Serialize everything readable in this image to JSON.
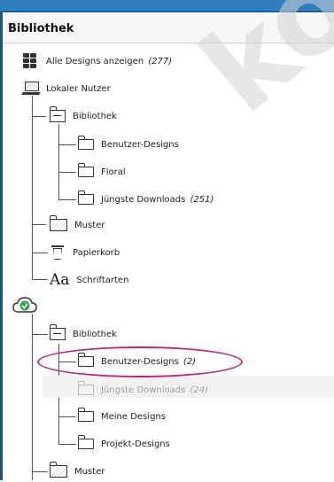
{
  "header": {
    "title": "Bibliothek"
  },
  "tree": {
    "all_designs": {
      "label": "Alle Designs anzeigen",
      "count": "(277)"
    },
    "local_user": {
      "label": "Lokaler Nutzer"
    },
    "local_library": {
      "label": "Bibliothek",
      "children": [
        {
          "label": "Benutzer-Designs",
          "count": ""
        },
        {
          "label": "Floral",
          "count": ""
        },
        {
          "label": "Jüngste Downloads",
          "count": "(251)"
        }
      ]
    },
    "local_muster": {
      "label": "Muster"
    },
    "trash": {
      "label": "Papierkorb"
    },
    "fonts": {
      "label": "Schriftarten",
      "glyph": "Aa"
    },
    "cloud_library": {
      "label": "Bibliothek",
      "children": [
        {
          "label": "Benutzer-Designs",
          "count": "(2)",
          "state": "normal"
        },
        {
          "label": "Jüngste Downloads",
          "count": "(24)",
          "state": "disabled"
        },
        {
          "label": "Meine Designs",
          "count": "",
          "state": "normal"
        },
        {
          "label": "Projekt-Designs",
          "count": "",
          "state": "normal"
        }
      ]
    },
    "cloud_muster": {
      "label": "Muster"
    }
  },
  "watermark": {
    "text": "kobi"
  },
  "colors": {
    "accent": "#2f7fbf",
    "annotation": "#c0286e",
    "cloud": "#3aa64a"
  }
}
